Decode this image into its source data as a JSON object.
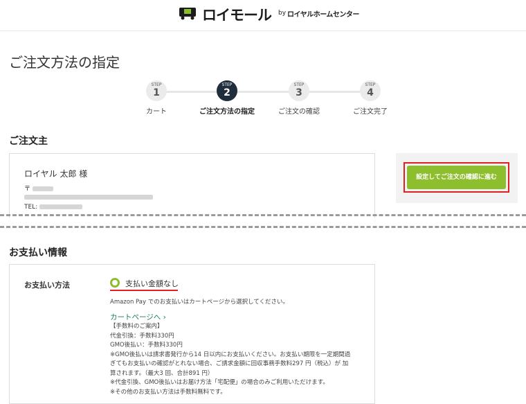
{
  "header": {
    "logo_text": "ロイモール",
    "logo_by": "by",
    "logo_sub": "ロイヤルホームセンター"
  },
  "page_title": "ご注文方法の指定",
  "steps": [
    {
      "label_small": "STEP",
      "number": "1",
      "label": "カート"
    },
    {
      "label_small": "STEP",
      "number": "2",
      "label": "ご注文方法の指定"
    },
    {
      "label_small": "STEP",
      "number": "3",
      "label": "ご注文の確認"
    },
    {
      "label_small": "STEP",
      "number": "4",
      "label": "ご注文完了"
    }
  ],
  "active_step": 2,
  "orderer": {
    "heading": "ご注文主",
    "name": "ロイヤル 太郎 様",
    "zip_prefix": "〒",
    "tel_prefix": "TEL:"
  },
  "proceed_button": "設定してご注文の確認に進む",
  "payment": {
    "heading": "お支払い情報",
    "method_label": "お支払い方法",
    "option_label": "支払い金額なし",
    "amazon_note": "Amazon Pay でのお支払いはカートページから選択してください。",
    "cart_link": "カートページへ ›",
    "fee_lines": [
      "【手数料のご案内】",
      "代金引換：手数料330円",
      "GMO後払い：手数料330円",
      "※GMO後払いは請求書発行から14 日以内にお支払いください。お支払い期限を一定期間過",
      "ぎてもお支払いの確認がとれない場合、ご請求金額に回収事務手数料297 円（税込）が 加",
      "算されます。（最大3 回、合計891 円）",
      "※代金引換、GMO後払いはお届け方法「宅配便」の場合のみご利用いただけます。",
      "※その他のお支払い方法は手数料無料です。"
    ]
  },
  "colors": {
    "accent_green": "#8cbe2e",
    "active_step": "#1f2d3d",
    "highlight_red": "#e02020",
    "link_green": "#1a7a5a"
  }
}
